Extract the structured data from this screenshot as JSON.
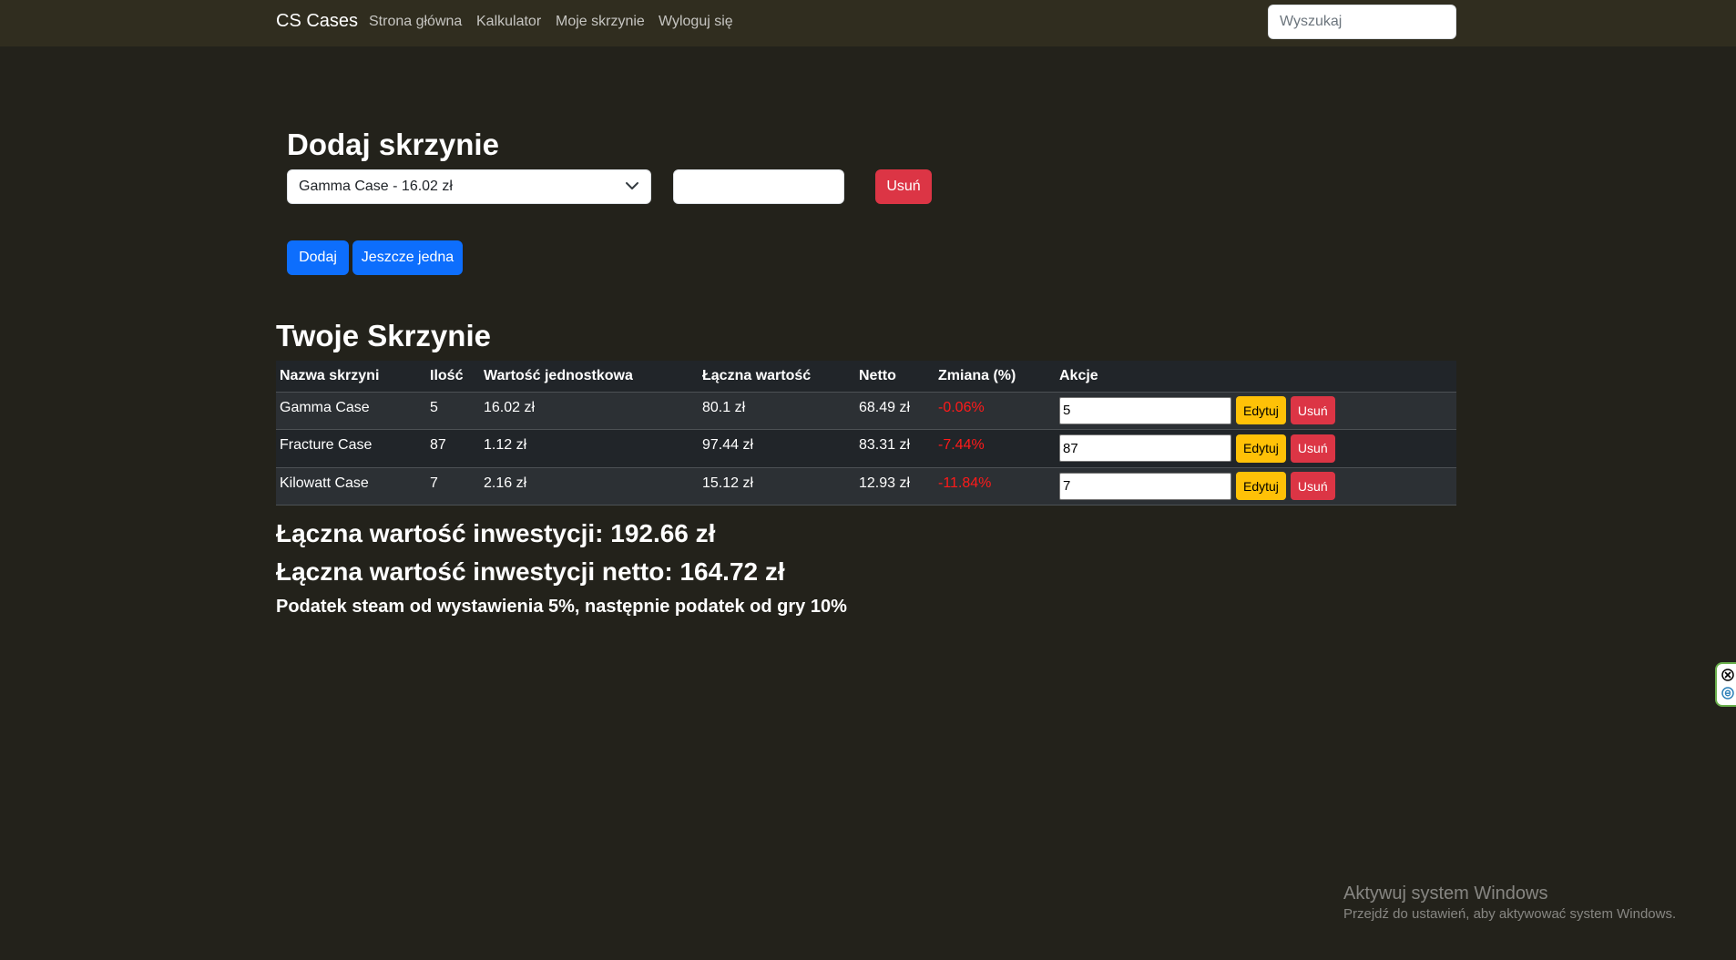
{
  "navbar": {
    "brand": "CS Cases",
    "links": [
      "Strona główna",
      "Kalkulator",
      "Moje skrzynie",
      "Wyloguj się"
    ],
    "search_placeholder": "Wyszukaj"
  },
  "add_section": {
    "title": "Dodaj skrzynie",
    "selected_case": "Gamma Case - 16.02 zł",
    "quantity_value": "",
    "remove_label": "Usuń",
    "add_label": "Dodaj",
    "add_another_label": "Jeszcze jedna"
  },
  "cases_section": {
    "title": "Twoje Skrzynie",
    "headers": [
      "Nazwa skrzyni",
      "Ilość",
      "Wartość jednostkowa",
      "Łączna wartość",
      "Netto",
      "Zmiana (%)",
      "Akcje"
    ],
    "rows": [
      {
        "name": "Gamma Case",
        "qty": "5",
        "unit": "16.02 zł",
        "total": "80.1 zł",
        "net": "68.49 zł",
        "change": "-0.06%",
        "input": "5"
      },
      {
        "name": "Fracture Case",
        "qty": "87",
        "unit": "1.12 zł",
        "total": "97.44 zł",
        "net": "83.31 zł",
        "change": "-7.44%",
        "input": "87"
      },
      {
        "name": "Kilowatt Case",
        "qty": "7",
        "unit": "2.16 zł",
        "total": "15.12 zł",
        "net": "12.93 zł",
        "change": "-11.84%",
        "input": "7"
      }
    ],
    "edit_label": "Edytuj",
    "delete_label": "Usuń"
  },
  "summary": {
    "total": "Łączna wartość inwestycji: 192.66 zł",
    "total_net": "Łączna wartość inwestycji netto: 164.72 zł",
    "tax_note": "Podatek steam od wystawienia 5%, następnie podatek od gry 10%"
  },
  "watermark": {
    "title": "Aktywuj system Windows",
    "subtitle": "Przejdź do ustawień, aby aktywować system Windows."
  },
  "colors": {
    "page_bg": "#23221b",
    "navbar_bg": "#302d1f",
    "primary": "#0d6efd",
    "danger": "#dc3545",
    "warning": "#ffc107",
    "negative_change": "#ff1a1a"
  },
  "icons": {
    "select_chevron": "chevron-down-icon",
    "side_widget": [
      "close-circle-icon",
      "extension-e-icon"
    ]
  }
}
